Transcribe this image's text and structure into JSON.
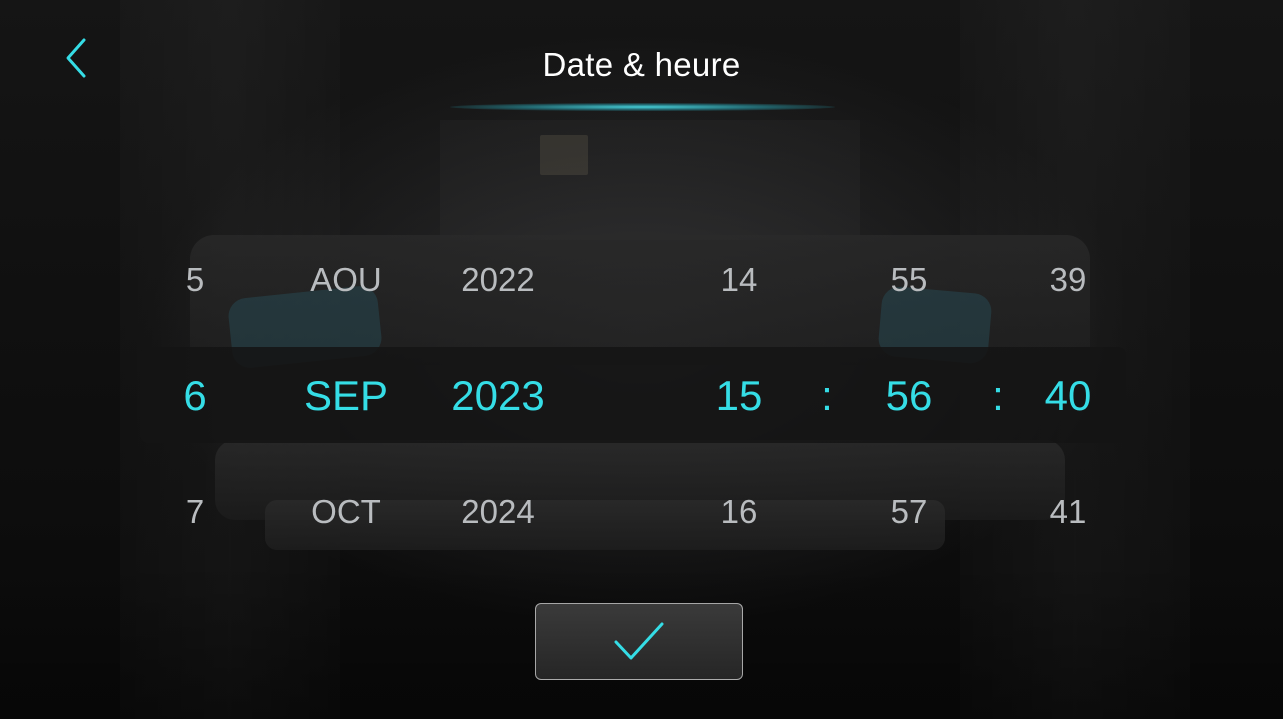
{
  "header": {
    "title": "Date & heure",
    "back_icon": "chevron-left-icon"
  },
  "picker": {
    "day": {
      "prev": "5",
      "current": "6",
      "next": "7"
    },
    "month": {
      "prev": "AOU",
      "current": "SEP",
      "next": "OCT"
    },
    "year": {
      "prev": "2022",
      "current": "2023",
      "next": "2024"
    },
    "hour": {
      "prev": "14",
      "current": "15",
      "next": "16"
    },
    "minute": {
      "prev": "55",
      "current": "56",
      "next": "57"
    },
    "second": {
      "prev": "39",
      "current": "40",
      "next": "41"
    },
    "separator": ":"
  },
  "confirm": {
    "icon": "checkmark-icon"
  },
  "colors": {
    "accent": "#35dde6",
    "inactive_text": "#b9bcbf",
    "title_text": "#ffffff",
    "band": "#141414"
  }
}
